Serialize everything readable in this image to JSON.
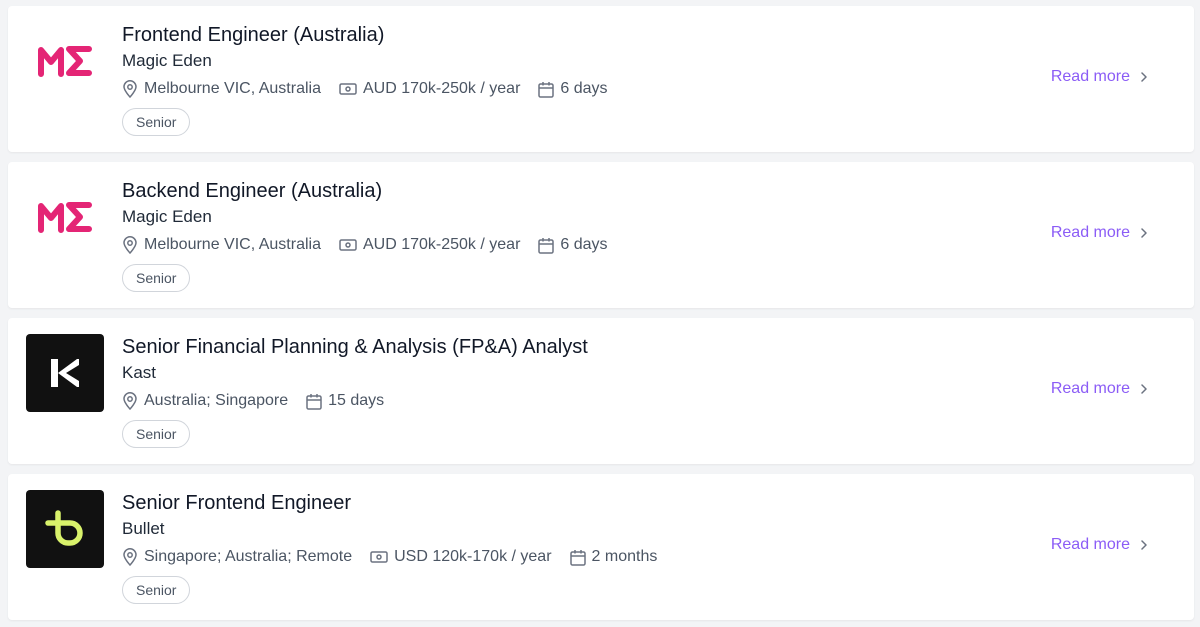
{
  "colors": {
    "accent": "#8b5cf6",
    "magic_eden_brand": "#e42575",
    "kast_bg": "#111111",
    "bullet_bg": "#111111",
    "bullet_accent": "#d9f26b"
  },
  "jobs": [
    {
      "title": "Frontend Engineer (Australia)",
      "company": "Magic Eden",
      "logo_icon": "magic-eden-logo",
      "location": "Melbourne VIC, Australia",
      "salary": "AUD 170k-250k / year",
      "posted": "6 days",
      "tag": "Senior",
      "read_more": "Read more"
    },
    {
      "title": "Backend Engineer (Australia)",
      "company": "Magic Eden",
      "logo_icon": "magic-eden-logo",
      "location": "Melbourne VIC, Australia",
      "salary": "AUD 170k-250k / year",
      "posted": "6 days",
      "tag": "Senior",
      "read_more": "Read more"
    },
    {
      "title": "Senior Financial Planning & Analysis (FP&A) Analyst",
      "company": "Kast",
      "logo_icon": "kast-logo",
      "location": "Australia; Singapore",
      "posted": "15 days",
      "tag": "Senior",
      "read_more": "Read more"
    },
    {
      "title": "Senior Frontend Engineer",
      "company": "Bullet",
      "logo_icon": "bullet-logo",
      "location": "Singapore; Australia; Remote",
      "salary": "USD 120k-170k / year",
      "posted": "2 months",
      "tag": "Senior",
      "read_more": "Read more"
    }
  ]
}
